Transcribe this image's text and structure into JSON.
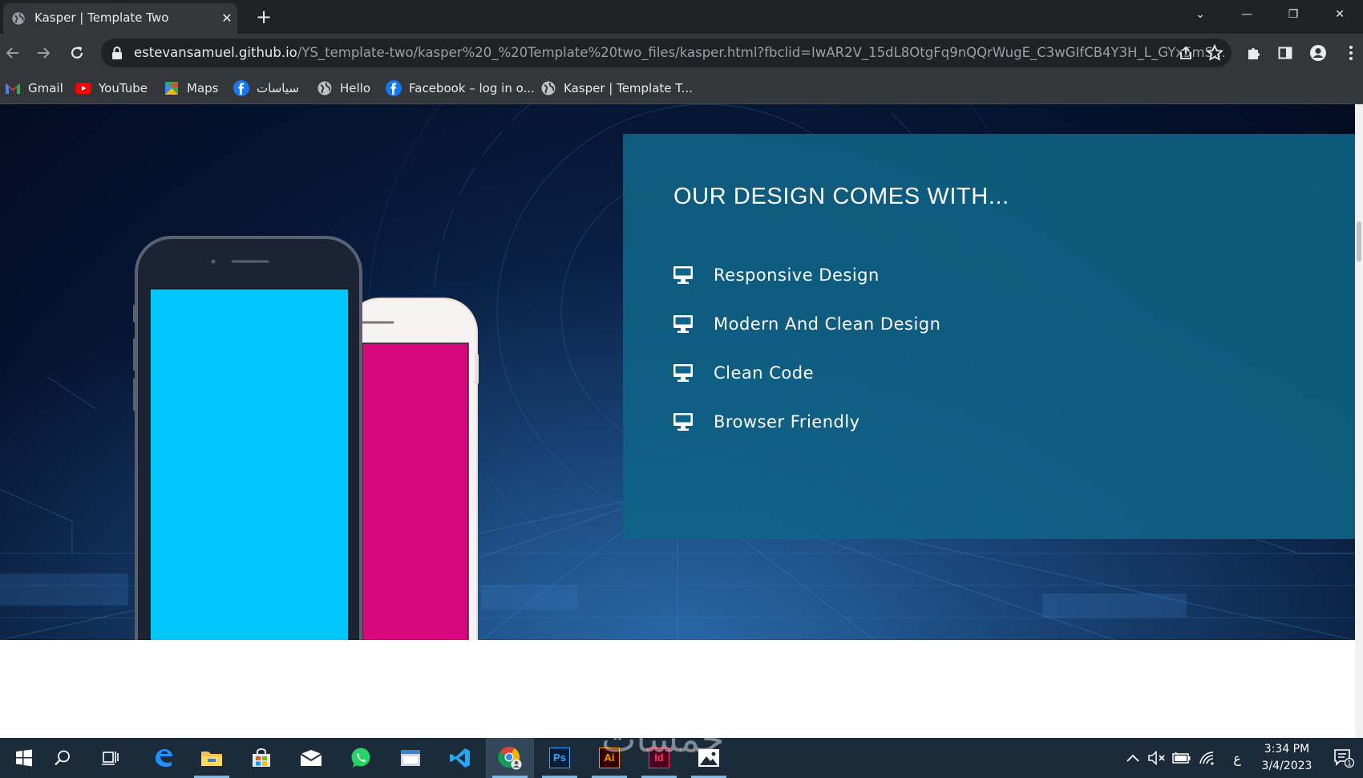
{
  "browser": {
    "tab": {
      "title": "Kasper | Template Two",
      "close": "✕"
    },
    "new_tab": "+",
    "window_controls": [
      "⌄",
      "—",
      "❐",
      "✕"
    ],
    "url_host": "estevansamuel.github.io",
    "url_path": "/YS_template-two/kasper%20_%20Template%20two_files/kasper.html?fbclid=IwAR2V_15dL8OtgFq9nQQrWugE_C3wGIfCB4Y3H_L_GYx5mS...",
    "bookmarks": [
      {
        "label": "Gmail",
        "icon": "gmail-icon"
      },
      {
        "label": "YouTube",
        "icon": "youtube-icon"
      },
      {
        "label": "Maps",
        "icon": "maps-icon"
      },
      {
        "label": "سياسات",
        "icon": "facebook-icon"
      },
      {
        "label": "Hello",
        "icon": "globe-icon"
      },
      {
        "label": "Facebook – log in o...",
        "icon": "facebook-icon"
      },
      {
        "label": "Kasper | Template T...",
        "icon": "globe-icon"
      }
    ]
  },
  "page": {
    "heading": "OUR DESIGN COMES WITH...",
    "features": [
      {
        "label": "Responsive Design",
        "icon": "desktop-icon"
      },
      {
        "label": "Modern And Clean Design",
        "icon": "desktop-icon"
      },
      {
        "label": "Clean Code",
        "icon": "desktop-icon"
      },
      {
        "label": "Browser Friendly",
        "icon": "desktop-icon"
      }
    ],
    "colors": {
      "panel": "#0f6487",
      "phone_front_screen": "#00c8ff",
      "phone_back_screen": "#d9077e"
    }
  },
  "taskbar": {
    "apps": [
      "windows-start",
      "search",
      "task-view",
      "edge",
      "file-explorer",
      "store",
      "mail",
      "whatsapp",
      "window-app",
      "vscode",
      "chrome",
      "photoshop",
      "illustrator",
      "indesign",
      "photos"
    ],
    "photoshop_label": "Ps",
    "illustrator_label": "Ai",
    "indesign_label": "Id",
    "input_language": "ع",
    "time": "3:34 PM",
    "date": "3/4/2023",
    "notification_count": "1"
  },
  "watermark": "خمسات"
}
